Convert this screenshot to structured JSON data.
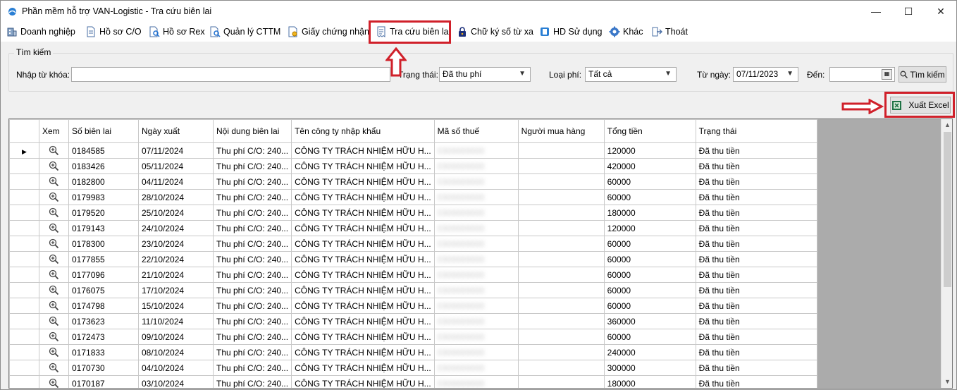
{
  "window": {
    "title": "Phần mềm hỗ trợ VAN-Logistic - Tra cứu biên lai",
    "minimize": "—",
    "maximize": "☐",
    "close": "✕"
  },
  "menu": [
    {
      "name": "menu-doanh-nghiep",
      "label": "Doanh nghiệp",
      "icon": "building-icon"
    },
    {
      "name": "menu-ho-so-co",
      "label": "Hồ sơ C/O",
      "icon": "document-icon"
    },
    {
      "name": "menu-ho-so-rex",
      "label": "Hồ sơ Rex",
      "icon": "document-search-icon"
    },
    {
      "name": "menu-quan-ly-cttm",
      "label": "Quản lý CTTM",
      "icon": "document-search-icon"
    },
    {
      "name": "menu-giay-chung-nhan",
      "label": "Giấy chứng nhận",
      "icon": "certificate-icon"
    },
    {
      "name": "menu-tra-cuu-bien-lai",
      "label": "Tra cứu biên lai",
      "icon": "receipt-icon"
    },
    {
      "name": "menu-chu-ky-so",
      "label": "Chữ ký số từ xa",
      "icon": "lock-icon"
    },
    {
      "name": "menu-hd-su-dung",
      "label": "HD Sử dụng",
      "icon": "help-icon"
    },
    {
      "name": "menu-khac",
      "label": "Khác",
      "icon": "gear-icon"
    },
    {
      "name": "menu-thoat",
      "label": "Thoát",
      "icon": "exit-icon"
    }
  ],
  "search": {
    "legend": "Tìm kiếm",
    "keyword_label": "Nhập từ khóa:",
    "keyword_value": "",
    "status_label": "Trạng thái:",
    "status_value": "Đã thu phí",
    "fee_type_label": "Loại phí:",
    "fee_type_value": "Tất cả",
    "from_label": "Từ ngày:",
    "from_value": "07/11/2023",
    "to_label": "Đến:",
    "to_value": "",
    "search_button": "Tìm kiếm"
  },
  "export_button": "Xuất Excel",
  "table": {
    "columns": {
      "view": "Xem",
      "receipt_no": "Số biên lai",
      "date": "Ngày xuất",
      "content": "Nội dung biên lai",
      "company": "Tên công ty nhập khẩu",
      "tax_code": "Mã số thuế",
      "buyer": "Người mua hàng",
      "total": "Tổng tiền",
      "status": "Trạng thái"
    },
    "rows": [
      {
        "receipt_no": "0184585",
        "date": "07/11/2024",
        "content": "Thu phí C/O: 240...",
        "company": "CÔNG TY TRÁCH NHIỆM HỮU H...",
        "tax_code": "0300000000",
        "buyer": "",
        "total": "120000",
        "status": "Đã thu tiền"
      },
      {
        "receipt_no": "0183426",
        "date": "05/11/2024",
        "content": "Thu phí C/O: 240...",
        "company": "CÔNG TY TRÁCH NHIỆM HỮU H...",
        "tax_code": "0300000000",
        "buyer": "",
        "total": "420000",
        "status": "Đã thu tiền"
      },
      {
        "receipt_no": "0182800",
        "date": "04/11/2024",
        "content": "Thu phí C/O: 240...",
        "company": "CÔNG TY TRÁCH NHIỆM HỮU H...",
        "tax_code": "0300000000",
        "buyer": "",
        "total": "60000",
        "status": "Đã thu tiền"
      },
      {
        "receipt_no": "0179983",
        "date": "28/10/2024",
        "content": "Thu phí C/O: 240...",
        "company": "CÔNG TY TRÁCH NHIỆM HỮU H...",
        "tax_code": "0300000000",
        "buyer": "",
        "total": "60000",
        "status": "Đã thu tiền"
      },
      {
        "receipt_no": "0179520",
        "date": "25/10/2024",
        "content": "Thu phí C/O: 240...",
        "company": "CÔNG TY TRÁCH NHIỆM HỮU H...",
        "tax_code": "0300000000",
        "buyer": "",
        "total": "180000",
        "status": "Đã thu tiền"
      },
      {
        "receipt_no": "0179143",
        "date": "24/10/2024",
        "content": "Thu phí C/O: 240...",
        "company": "CÔNG TY TRÁCH NHIỆM HỮU H...",
        "tax_code": "0300000000",
        "buyer": "",
        "total": "120000",
        "status": "Đã thu tiền"
      },
      {
        "receipt_no": "0178300",
        "date": "23/10/2024",
        "content": "Thu phí C/O: 240...",
        "company": "CÔNG TY TRÁCH NHIỆM HỮU H...",
        "tax_code": "0300000000",
        "buyer": "",
        "total": "60000",
        "status": "Đã thu tiền"
      },
      {
        "receipt_no": "0177855",
        "date": "22/10/2024",
        "content": "Thu phí C/O: 240...",
        "company": "CÔNG TY TRÁCH NHIỆM HỮU H...",
        "tax_code": "0300000000",
        "buyer": "",
        "total": "60000",
        "status": "Đã thu tiền"
      },
      {
        "receipt_no": "0177096",
        "date": "21/10/2024",
        "content": "Thu phí C/O: 240...",
        "company": "CÔNG TY TRÁCH NHIỆM HỮU H...",
        "tax_code": "0300000000",
        "buyer": "",
        "total": "60000",
        "status": "Đã thu tiền"
      },
      {
        "receipt_no": "0176075",
        "date": "17/10/2024",
        "content": "Thu phí C/O: 240...",
        "company": "CÔNG TY TRÁCH NHIỆM HỮU H...",
        "tax_code": "0300000000",
        "buyer": "",
        "total": "60000",
        "status": "Đã thu tiền"
      },
      {
        "receipt_no": "0174798",
        "date": "15/10/2024",
        "content": "Thu phí C/O: 240...",
        "company": "CÔNG TY TRÁCH NHIỆM HỮU H...",
        "tax_code": "0300000000",
        "buyer": "",
        "total": "60000",
        "status": "Đã thu tiền"
      },
      {
        "receipt_no": "0173623",
        "date": "11/10/2024",
        "content": "Thu phí C/O: 240...",
        "company": "CÔNG TY TRÁCH NHIỆM HỮU H...",
        "tax_code": "0300000000",
        "buyer": "",
        "total": "360000",
        "status": "Đã thu tiền"
      },
      {
        "receipt_no": "0172473",
        "date": "09/10/2024",
        "content": "Thu phí C/O: 240...",
        "company": "CÔNG TY TRÁCH NHIỆM HỮU H...",
        "tax_code": "0300000000",
        "buyer": "",
        "total": "60000",
        "status": "Đã thu tiền"
      },
      {
        "receipt_no": "0171833",
        "date": "08/10/2024",
        "content": "Thu phí C/O: 240...",
        "company": "CÔNG TY TRÁCH NHIỆM HỮU H...",
        "tax_code": "0300000000",
        "buyer": "",
        "total": "240000",
        "status": "Đã thu tiền"
      },
      {
        "receipt_no": "0170730",
        "date": "04/10/2024",
        "content": "Thu phí C/O: 240...",
        "company": "CÔNG TY TRÁCH NHIỆM HỮU H...",
        "tax_code": "0300000000",
        "buyer": "",
        "total": "300000",
        "status": "Đã thu tiền"
      },
      {
        "receipt_no": "0170187",
        "date": "03/10/2024",
        "content": "Thu phí C/O: 240...",
        "company": "CÔNG TY TRÁCH NHIỆM HỮU H...",
        "tax_code": "0300000000",
        "buyer": "",
        "total": "180000",
        "status": "Đã thu tiền"
      }
    ]
  },
  "colors": {
    "highlight": "#d0202a",
    "window_bg": "#f0f0f0",
    "grid_bg": "#ababab"
  }
}
